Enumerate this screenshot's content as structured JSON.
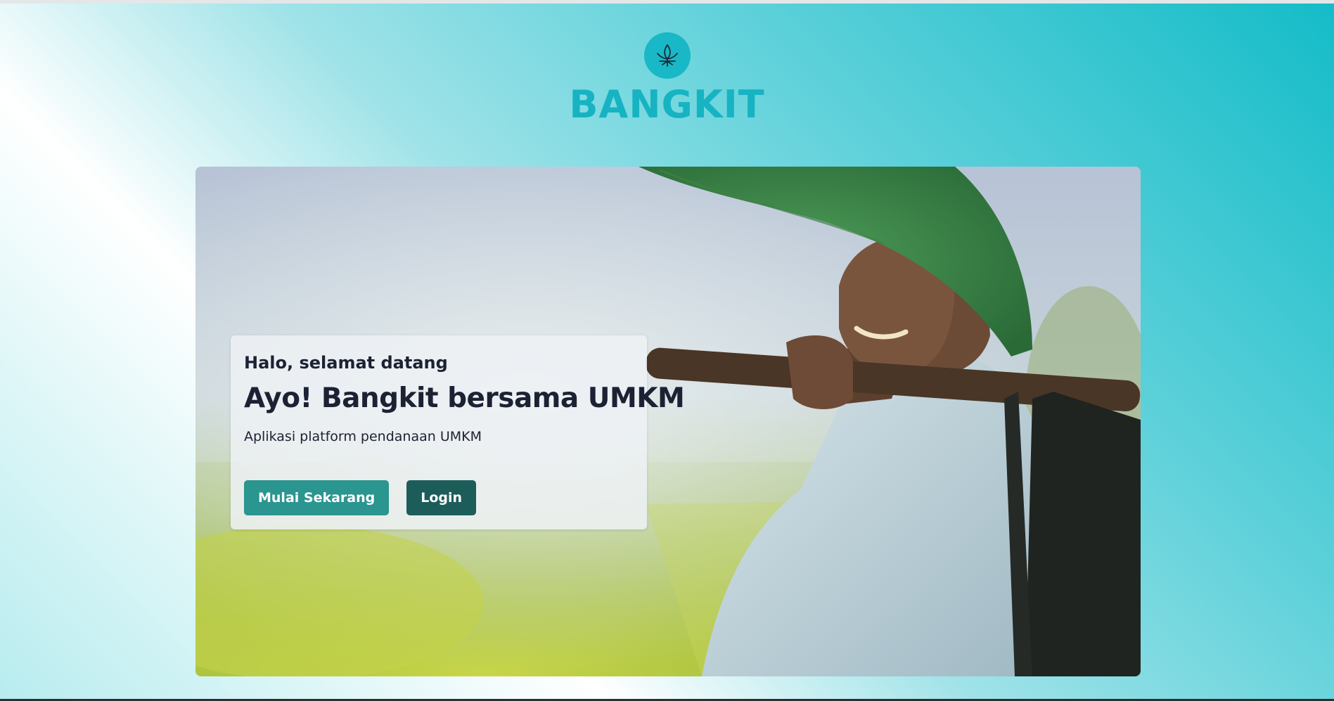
{
  "brand": {
    "name": "BANGKIT",
    "logo_icon": "lotus-icon",
    "color": "#17b3c2"
  },
  "hero": {
    "image": "farmer-photo",
    "card": {
      "greeting": "Halo, selamat datang",
      "headline": "Ayo! Bangkit bersama UMKM",
      "subtitle": "Aplikasi platform pendanaan UMKM"
    },
    "buttons": {
      "start_label": "Mulai Sekarang",
      "login_label": "Login"
    }
  },
  "colors": {
    "primary_button": "#2b958f",
    "secondary_button": "#1c5d5a",
    "accent": "#19b8c6"
  }
}
